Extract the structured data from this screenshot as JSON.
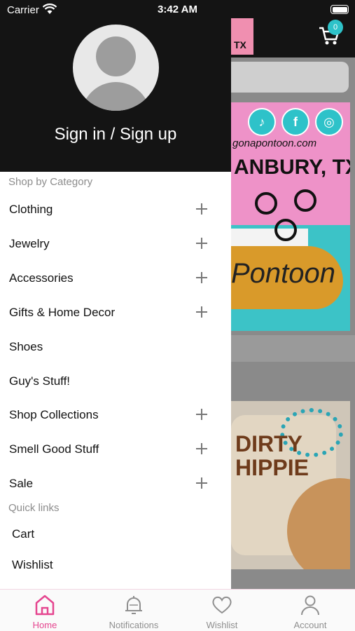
{
  "status_bar": {
    "carrier": "Carrier",
    "time": "3:42 AM"
  },
  "background": {
    "cart_count": "0",
    "banner_site": "gonapontoon.com",
    "banner_city": "ANBURY, TX",
    "banner_script": "Pontoon",
    "product_text_1": "DIRTY",
    "product_text_2": "HIPPIE",
    "logo_text": "TX"
  },
  "drawer": {
    "sign_in": "Sign in / Sign up",
    "shop_section": "Shop by Category",
    "categories": [
      {
        "label": "Clothing",
        "expandable": true
      },
      {
        "label": "Jewelry",
        "expandable": true
      },
      {
        "label": "Accessories",
        "expandable": true
      },
      {
        "label": "Gifts & Home Decor",
        "expandable": true
      },
      {
        "label": "Shoes",
        "expandable": false
      },
      {
        "label": "Guy's Stuff!",
        "expandable": false
      },
      {
        "label": "Shop Collections",
        "expandable": true
      },
      {
        "label": "Smell Good Stuff",
        "expandable": true
      },
      {
        "label": "Sale",
        "expandable": true
      }
    ],
    "quick_section": "Quick links",
    "quick_links": [
      {
        "label": "Cart"
      },
      {
        "label": "Wishlist"
      }
    ]
  },
  "tab_bar": {
    "tabs": [
      {
        "label": "Home",
        "icon": "home-icon",
        "active": true
      },
      {
        "label": "Notifications",
        "icon": "bell-icon",
        "active": false
      },
      {
        "label": "Wishlist",
        "icon": "heart-icon",
        "active": false
      },
      {
        "label": "Account",
        "icon": "person-icon",
        "active": false
      }
    ]
  },
  "colors": {
    "accent": "#e5458f",
    "header": "#141414",
    "teal": "#2ec2c9"
  }
}
